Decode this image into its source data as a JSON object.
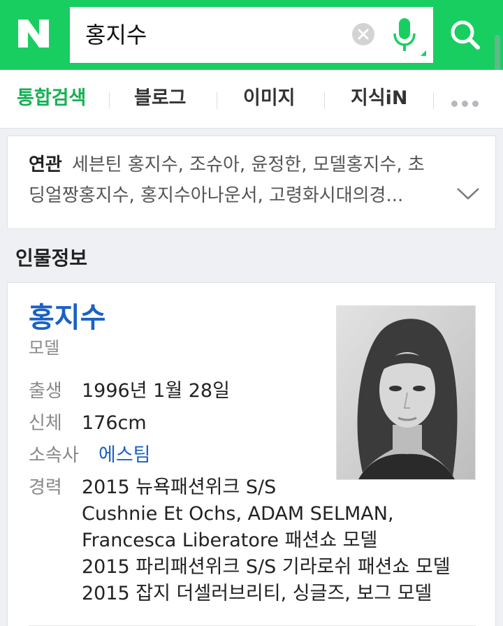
{
  "search": {
    "query": "홍지수"
  },
  "tabs": [
    "통합검색",
    "블로그",
    "이미지",
    "지식iN"
  ],
  "related": {
    "label": "연관",
    "line1": "세븐틴 홍지수, 조슈아, 윤정한, 모델홍지수, 초",
    "line2": "딩얼짱홍지수, 홍지수아나운서, 고령화시대의경..."
  },
  "section_title": "인물정보",
  "person": {
    "name": "홍지수",
    "job": "모델",
    "birth_label": "출생",
    "birth_value": "1996년 1월 28일",
    "body_label": "신체",
    "body_value": "176cm",
    "agency_label": "소속사",
    "agency_value": "에스팀",
    "career_label": "경력",
    "career": [
      "2015 뉴욕패션위크 S/S",
      "Cushnie Et Ochs, ADAM SELMAN,",
      "Francesca Liberatore 패션쇼 모델",
      "2015 파리패션위크 S/S 기라로쉬 패션쇼 모델",
      "2015 잡지 더셀러브리티, 싱글즈, 보그 모델"
    ]
  },
  "colors": {
    "brand_green": "#19ce60",
    "active_tab": "#16b054",
    "link_blue": "#1a61c4"
  }
}
